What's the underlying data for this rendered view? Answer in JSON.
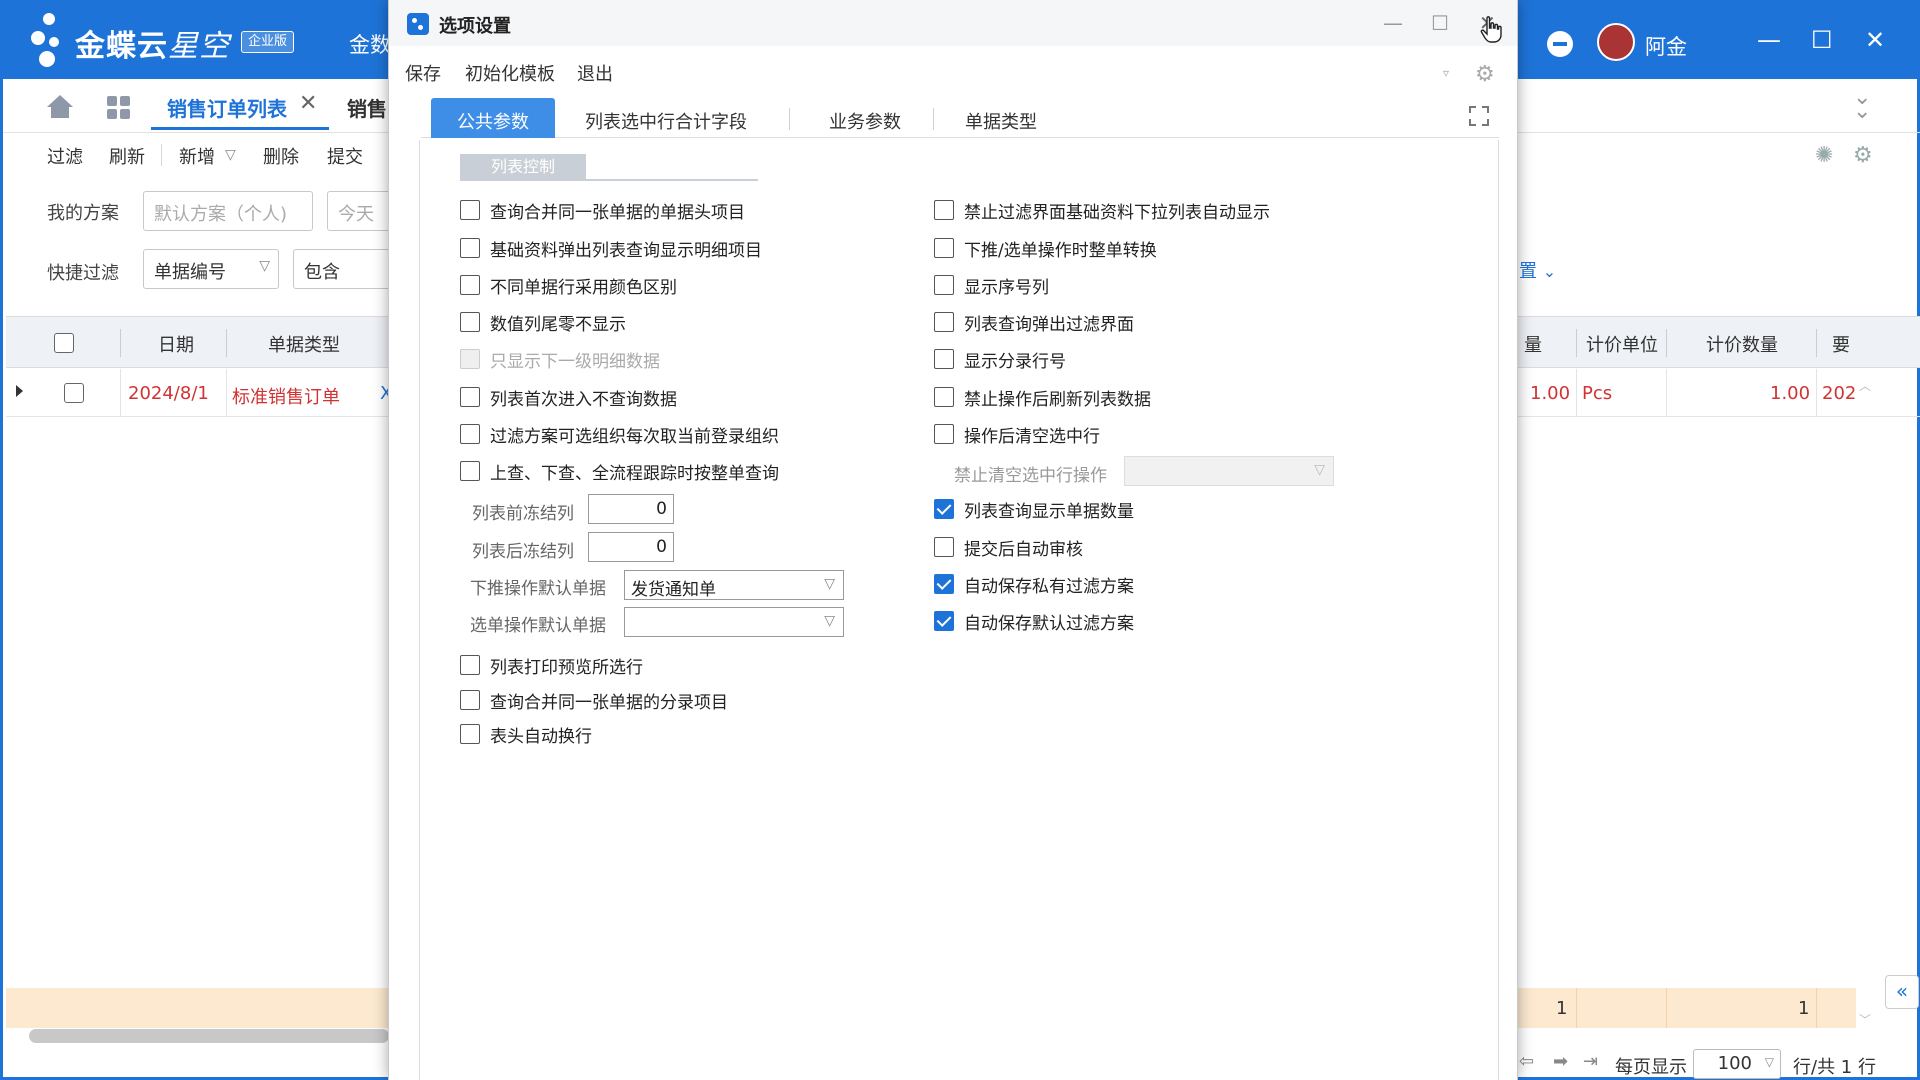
{
  "app": {
    "logo_text": "金蝶云",
    "logo_text_2": "星空",
    "edition_badge": "企业版",
    "top_left_text": "金数",
    "user_name": "阿金",
    "tabs": [
      {
        "label": "销售订单列表",
        "active": true
      },
      {
        "label": "销售",
        "active": false
      }
    ],
    "toolbar": [
      "过滤",
      "刷新",
      "新增",
      "删除",
      "提交"
    ],
    "filter": {
      "scheme_label": "我的方案",
      "scheme_value": "默认方案（个人)",
      "today_value": "今天",
      "quick_label": "快捷过滤",
      "field_value": "单据编号",
      "op_value": "包含",
      "right_link": "置"
    },
    "grid": {
      "headers_left": [
        "日期",
        "单据类型"
      ],
      "headers_right": [
        "量",
        "计价单位",
        "计价数量",
        "要"
      ],
      "row": {
        "date": "2024/8/1",
        "type": "标准销售订单",
        "partial": "X",
        "qty": "1.00",
        "unit": "Pcs",
        "price_qty": "1.00",
        "extra": "202"
      },
      "sum": {
        "a": "1",
        "b": "1"
      }
    },
    "pager": {
      "per_page_label": "每页显示",
      "per_page_value": "100",
      "total": "行/共 1 行"
    }
  },
  "dialog": {
    "title": "选项设置",
    "menu": [
      "保存",
      "初始化模板",
      "退出"
    ],
    "tabs": [
      {
        "label": "公共参数",
        "active": true
      },
      {
        "label": "列表选中行合计字段",
        "active": false
      },
      {
        "label": "业务参数",
        "active": false
      },
      {
        "label": "单据类型",
        "active": false
      }
    ],
    "group_title": "列表控制",
    "left_options_top": [
      {
        "label": "查询合并同一张单据的单据头项目",
        "checked": false,
        "disabled": false
      },
      {
        "label": "基础资料弹出列表查询显示明细项目",
        "checked": false,
        "disabled": false
      },
      {
        "label": "不同单据行采用颜色区别",
        "checked": false,
        "disabled": false
      },
      {
        "label": "数值列尾零不显示",
        "checked": false,
        "disabled": false
      },
      {
        "label": "只显示下一级明细数据",
        "checked": false,
        "disabled": true
      },
      {
        "label": "列表首次进入不查询数据",
        "checked": false,
        "disabled": false
      },
      {
        "label": "过滤方案可选组织每次取当前登录组织",
        "checked": false,
        "disabled": false
      },
      {
        "label": "上查、下查、全流程跟踪时按整单查询",
        "checked": false,
        "disabled": false
      }
    ],
    "fields": {
      "freeze_front_label": "列表前冻结列",
      "freeze_front_value": "0",
      "freeze_back_label": "列表后冻结列",
      "freeze_back_value": "0",
      "push_default_label": "下推操作默认单据",
      "push_default_value": "发货通知单",
      "select_default_label": "选单操作默认单据",
      "select_default_value": ""
    },
    "left_options_bottom": [
      {
        "label": "列表打印预览所选行",
        "checked": false
      },
      {
        "label": "查询合并同一张单据的分录项目",
        "checked": false
      },
      {
        "label": "表头自动换行",
        "checked": false
      }
    ],
    "right_options_top": [
      {
        "label": "禁止过滤界面基础资料下拉列表自动显示",
        "checked": false
      },
      {
        "label": "下推/选单操作时整单转换",
        "checked": false
      },
      {
        "label": "显示序号列",
        "checked": false
      },
      {
        "label": "列表查询弹出过滤界面",
        "checked": false
      },
      {
        "label": "显示分录行号",
        "checked": false
      },
      {
        "label": "禁止操作后刷新列表数据",
        "checked": false
      },
      {
        "label": "操作后清空选中行",
        "checked": false
      }
    ],
    "clear_op_label": "禁止清空选中行操作",
    "clear_op_value": "",
    "right_options_bottom": [
      {
        "label": "列表查询显示单据数量",
        "checked": true
      },
      {
        "label": "提交后自动审核",
        "checked": false
      },
      {
        "label": "自动保存私有过滤方案",
        "checked": true
      },
      {
        "label": "自动保存默认过滤方案",
        "checked": true
      }
    ]
  }
}
